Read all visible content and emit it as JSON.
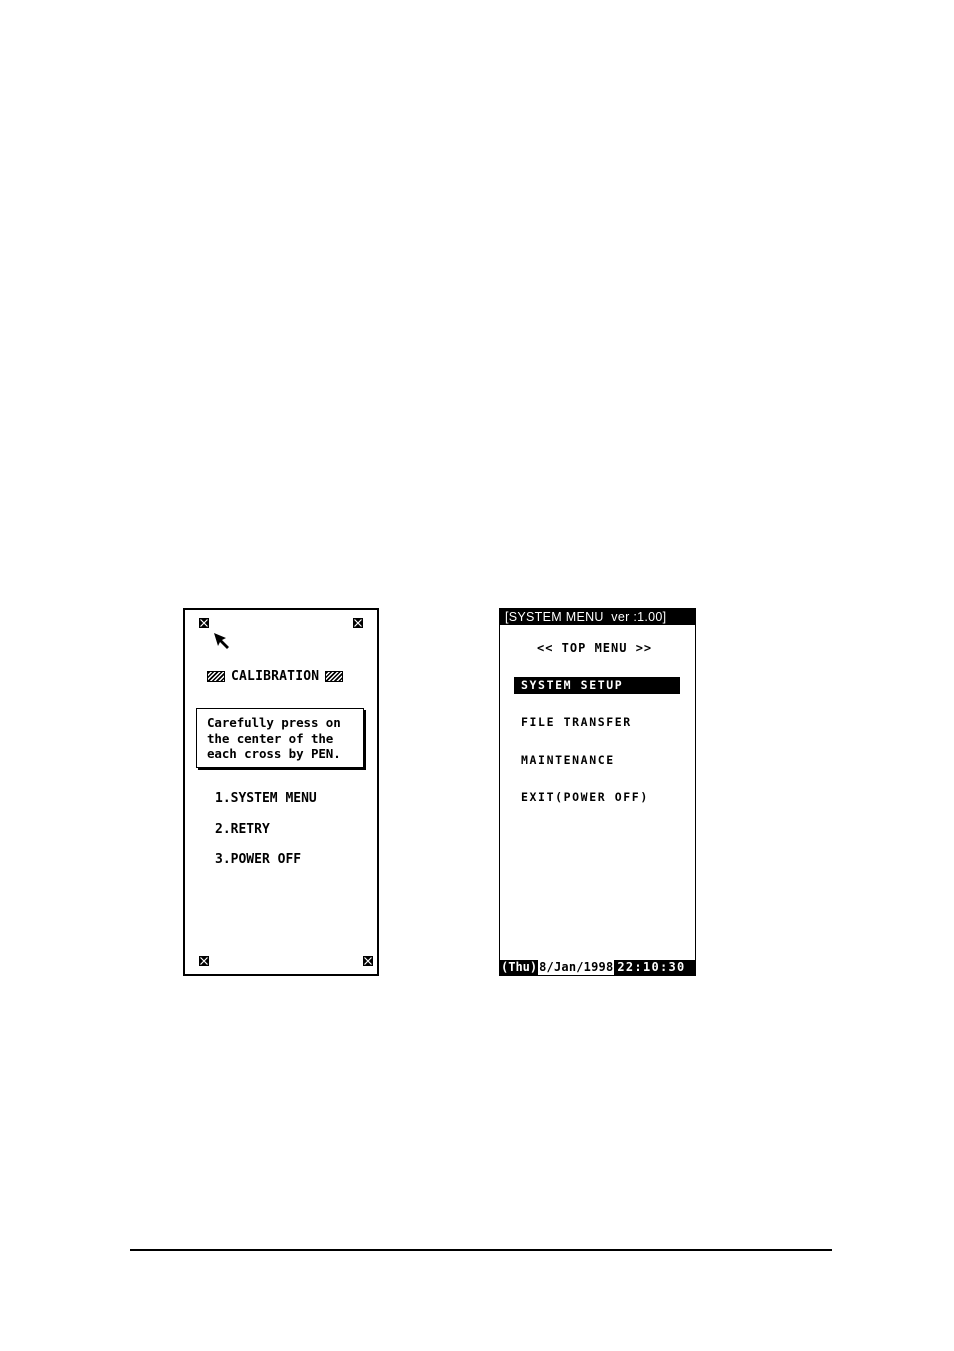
{
  "calibration_screen": {
    "title": "CALIBRATION",
    "title_decoration_icon": "hatch-pattern",
    "cross_markers": [
      "top-left",
      "top-right",
      "bottom-left",
      "bottom-right"
    ],
    "cross_marker_icon": "boxed-x-icon",
    "pointer_icon": "arrow-cursor-icon",
    "instruction": "Carefully press on\nthe center of the\neach cross by PEN.",
    "menu_items": [
      {
        "label": "1.SYSTEM MENU"
      },
      {
        "label": "2.RETRY"
      },
      {
        "label": "3.POWER OFF"
      }
    ]
  },
  "system_menu_screen": {
    "title_bar": "[SYSTEM MENU  ver :1.00]",
    "heading": "<< TOP MENU >>",
    "menu_items": [
      {
        "label": "SYSTEM SETUP",
        "selected": true
      },
      {
        "label": "FILE TRANSFER",
        "selected": false
      },
      {
        "label": "MAINTENANCE",
        "selected": false
      },
      {
        "label": "EXIT(POWER OFF)",
        "selected": false
      }
    ],
    "status_bar": {
      "day": "(Thu)",
      "date": "8/Jan/1998",
      "time": "22:10:30"
    }
  },
  "colors": {
    "foreground": "#000000",
    "background": "#ffffff"
  }
}
